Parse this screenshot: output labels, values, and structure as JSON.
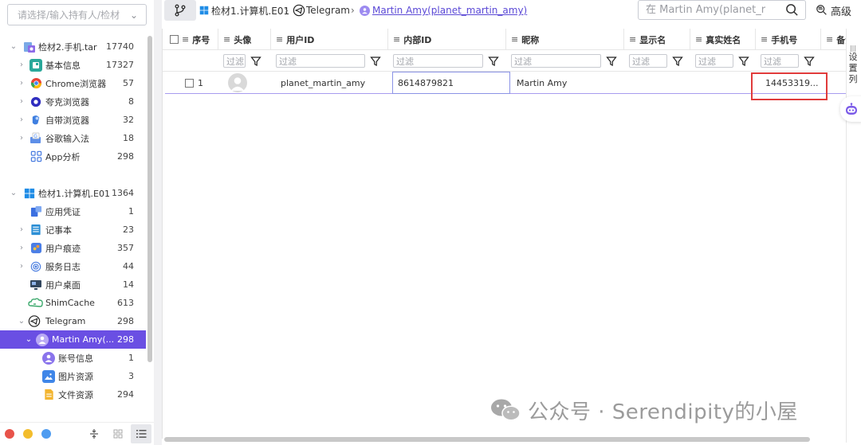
{
  "sidebar": {
    "search_placeholder": "请选择/输入持有人/检材",
    "tree": [
      {
        "label": "检材2.手机.tar",
        "count": "17740",
        "icon": "android-archive-icon"
      },
      {
        "label": "基本信息",
        "count": "17327",
        "icon": "info-card-icon"
      },
      {
        "label": "Chrome浏览器",
        "count": "57",
        "icon": "chrome-icon"
      },
      {
        "label": "夸克浏览器",
        "count": "8",
        "icon": "quark-icon"
      },
      {
        "label": "自带浏览器",
        "count": "32",
        "icon": "builtin-browser-icon"
      },
      {
        "label": "谷歌输入法",
        "count": "18",
        "icon": "google-ime-icon"
      },
      {
        "label": "App分析",
        "count": "298",
        "icon": "app-grid-icon"
      },
      {
        "label": "检材1.计算机.E01",
        "count": "1364",
        "icon": "windows-icon"
      },
      {
        "label": "应用凭证",
        "count": "1",
        "icon": "credential-icon"
      },
      {
        "label": "记事本",
        "count": "23",
        "icon": "notepad-icon"
      },
      {
        "label": "用户痕迹",
        "count": "357",
        "icon": "user-trace-icon"
      },
      {
        "label": "服务日志",
        "count": "44",
        "icon": "service-log-icon"
      },
      {
        "label": "用户桌面",
        "count": "14",
        "icon": "desktop-icon"
      },
      {
        "label": "ShimCache",
        "count": "613",
        "icon": "shimcache-icon"
      },
      {
        "label": "Telegram",
        "count": "298",
        "icon": "telegram-icon"
      },
      {
        "label": "Martin Amy(...",
        "count": "298",
        "icon": "user-icon"
      },
      {
        "label": "账号信息",
        "count": "1",
        "icon": "account-icon"
      },
      {
        "label": "图片资源",
        "count": "3",
        "icon": "image-icon"
      },
      {
        "label": "文件资源",
        "count": "294",
        "icon": "file-icon"
      }
    ],
    "dots": [
      "#e8534a",
      "#f3bd2c",
      "#4f9cf0"
    ]
  },
  "topbar": {
    "crumbs": [
      "检材1.计算机.E01",
      "Telegram",
      "Martin Amy(planet_martin_amy)"
    ],
    "search_placeholder": "在 Martin Amy(planet_r",
    "advanced_label": "高级"
  },
  "grid": {
    "columns": [
      "序号",
      "头像",
      "用户ID",
      "内部ID",
      "昵称",
      "显示名",
      "真实姓名",
      "手机号",
      "备注"
    ],
    "filter_placeholder": "过滤",
    "rows": [
      {
        "index": "1",
        "user_id": "planet_martin_amy",
        "internal_id": "8614879821",
        "nickname": "Martin Amy",
        "display_name": "",
        "real_name": "",
        "phone": "14453319..."
      }
    ]
  },
  "right_panel": {
    "settings_label": "设置列"
  },
  "watermark": "公众号 · Serendipity的小屋",
  "colors": {
    "accent": "#6a4fe3",
    "highlight_border": "#e03b3b"
  }
}
